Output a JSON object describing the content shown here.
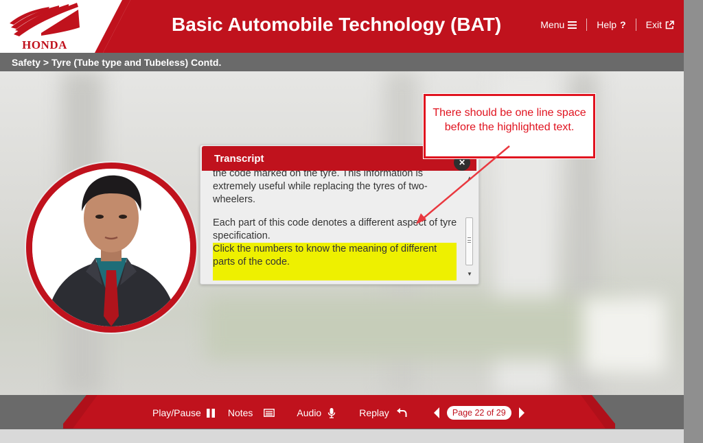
{
  "app": {
    "brand": "HONDA",
    "title": "Basic Automobile Technology (BAT)"
  },
  "topnav": {
    "menu_label": "Menu",
    "help_label": "Help",
    "exit_label": "Exit"
  },
  "breadcrumb": {
    "text": "Safety > Tyre (Tube type and Tubeless) Contd."
  },
  "transcript": {
    "title": "Transcript",
    "paragraphs": [
      "the code marked on the tyre. This information is extremely useful while replacing the tyres of two-wheelers.",
      "Each part of this code denotes a different aspect of tyre specification.",
      "Click the numbers to know the meaning of different parts of the code."
    ]
  },
  "annotation": {
    "text": "There should be one line space before the highlighted text."
  },
  "footer": {
    "play_pause_label": "Play/Pause",
    "notes_label": "Notes",
    "audio_label": "Audio",
    "replay_label": "Replay",
    "page_indicator": "Page 22 of 29"
  },
  "colors": {
    "brand_red": "#c0121d",
    "annotation_red": "#e0131f",
    "highlight_yellow": "#eef000",
    "crumb_gray": "#6a6a6a"
  }
}
